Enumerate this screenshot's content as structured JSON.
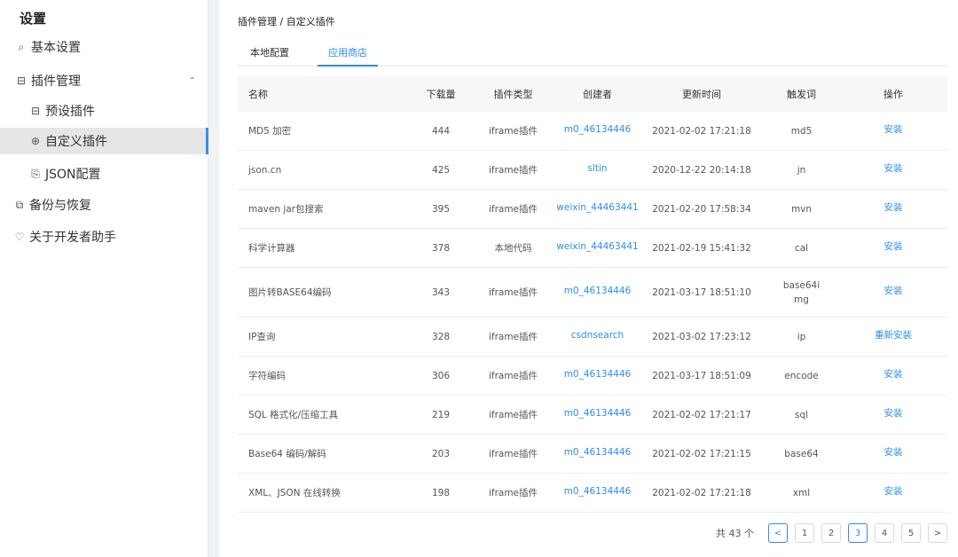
{
  "sidebar": {
    "title": "设置",
    "items": [
      {
        "label": "基本设置",
        "icon": "search-icon",
        "glyph": "⌕"
      },
      {
        "label": "插件管理",
        "icon": "plugin-icon",
        "glyph": "⊟"
      },
      {
        "label": "预设插件",
        "icon": "plugin-icon",
        "glyph": "⊟"
      },
      {
        "label": "自定义插件",
        "icon": "globe-icon",
        "glyph": "⊕"
      },
      {
        "label": "JSON配置",
        "icon": "file-icon",
        "glyph": "⎘"
      },
      {
        "label": "备份与恢复",
        "icon": "backup-icon",
        "glyph": "⧉"
      },
      {
        "label": "关于开发者助手",
        "icon": "bulb-icon",
        "glyph": "♡"
      }
    ],
    "caret": "⌃"
  },
  "main": {
    "breadcrumb": "插件管理 / 自定义插件",
    "tabs": [
      "本地配置",
      "应用商店"
    ],
    "columns": [
      "名称",
      "下载量",
      "插件类型",
      "创建者",
      "更新时间",
      "触发词",
      "操作"
    ],
    "rows": [
      {
        "name": "MD5 加密",
        "downloads": "444",
        "type": "iframe插件",
        "creator": "m0_46134446",
        "updated": "2021-02-02 17:21:18",
        "trigger": "md5",
        "action": "安装"
      },
      {
        "name": "json.cn",
        "downloads": "425",
        "type": "iframe插件",
        "creator": "sltin",
        "updated": "2020-12-22 20:14:18",
        "trigger": "jn",
        "action": "安装"
      },
      {
        "name": "maven jar包搜索",
        "downloads": "395",
        "type": "iframe插件",
        "creator": "weixin_44463441",
        "updated": "2021-02-20 17:58:34",
        "trigger": "mvn",
        "action": "安装"
      },
      {
        "name": "科学计算器",
        "downloads": "378",
        "type": "本地代码",
        "creator": "weixin_44463441",
        "updated": "2021-02-19 15:41:32",
        "trigger": "cal",
        "action": "安装"
      },
      {
        "name": "图片转BASE64编码",
        "downloads": "343",
        "type": "iframe插件",
        "creator": "m0_46134446",
        "updated": "2021-03-17 18:51:10",
        "trigger": "base64img",
        "action": "安装"
      },
      {
        "name": "IP查询",
        "downloads": "328",
        "type": "iframe插件",
        "creator": "csdnsearch",
        "updated": "2021-03-02 17:23:12",
        "trigger": "ip",
        "action": "重新安装"
      },
      {
        "name": "字符编码",
        "downloads": "306",
        "type": "iframe插件",
        "creator": "m0_46134446",
        "updated": "2021-03-17 18:51:09",
        "trigger": "encode",
        "action": "安装"
      },
      {
        "name": "SQL 格式化/压缩工具",
        "downloads": "219",
        "type": "iframe插件",
        "creator": "m0_46134446",
        "updated": "2021-02-02 17:21:17",
        "trigger": "sql",
        "action": "安装"
      },
      {
        "name": "Base64 编码/解码",
        "downloads": "203",
        "type": "iframe插件",
        "creator": "m0_46134446",
        "updated": "2021-02-02 17:21:15",
        "trigger": "base64",
        "action": "安装"
      },
      {
        "name": "XML、JSON 在线转换",
        "downloads": "198",
        "type": "iframe插件",
        "creator": "m0_46134446",
        "updated": "2021-02-02 17:21:18",
        "trigger": "xml",
        "action": "安装"
      }
    ],
    "pagination": {
      "total": "共 43 个",
      "prev": "<",
      "next": ">",
      "pages": [
        "1",
        "2",
        "3",
        "4",
        "5"
      ],
      "current": "3"
    }
  },
  "colors": {
    "accent": "#2d8cf0",
    "active_bg": "#e6e6e6"
  }
}
